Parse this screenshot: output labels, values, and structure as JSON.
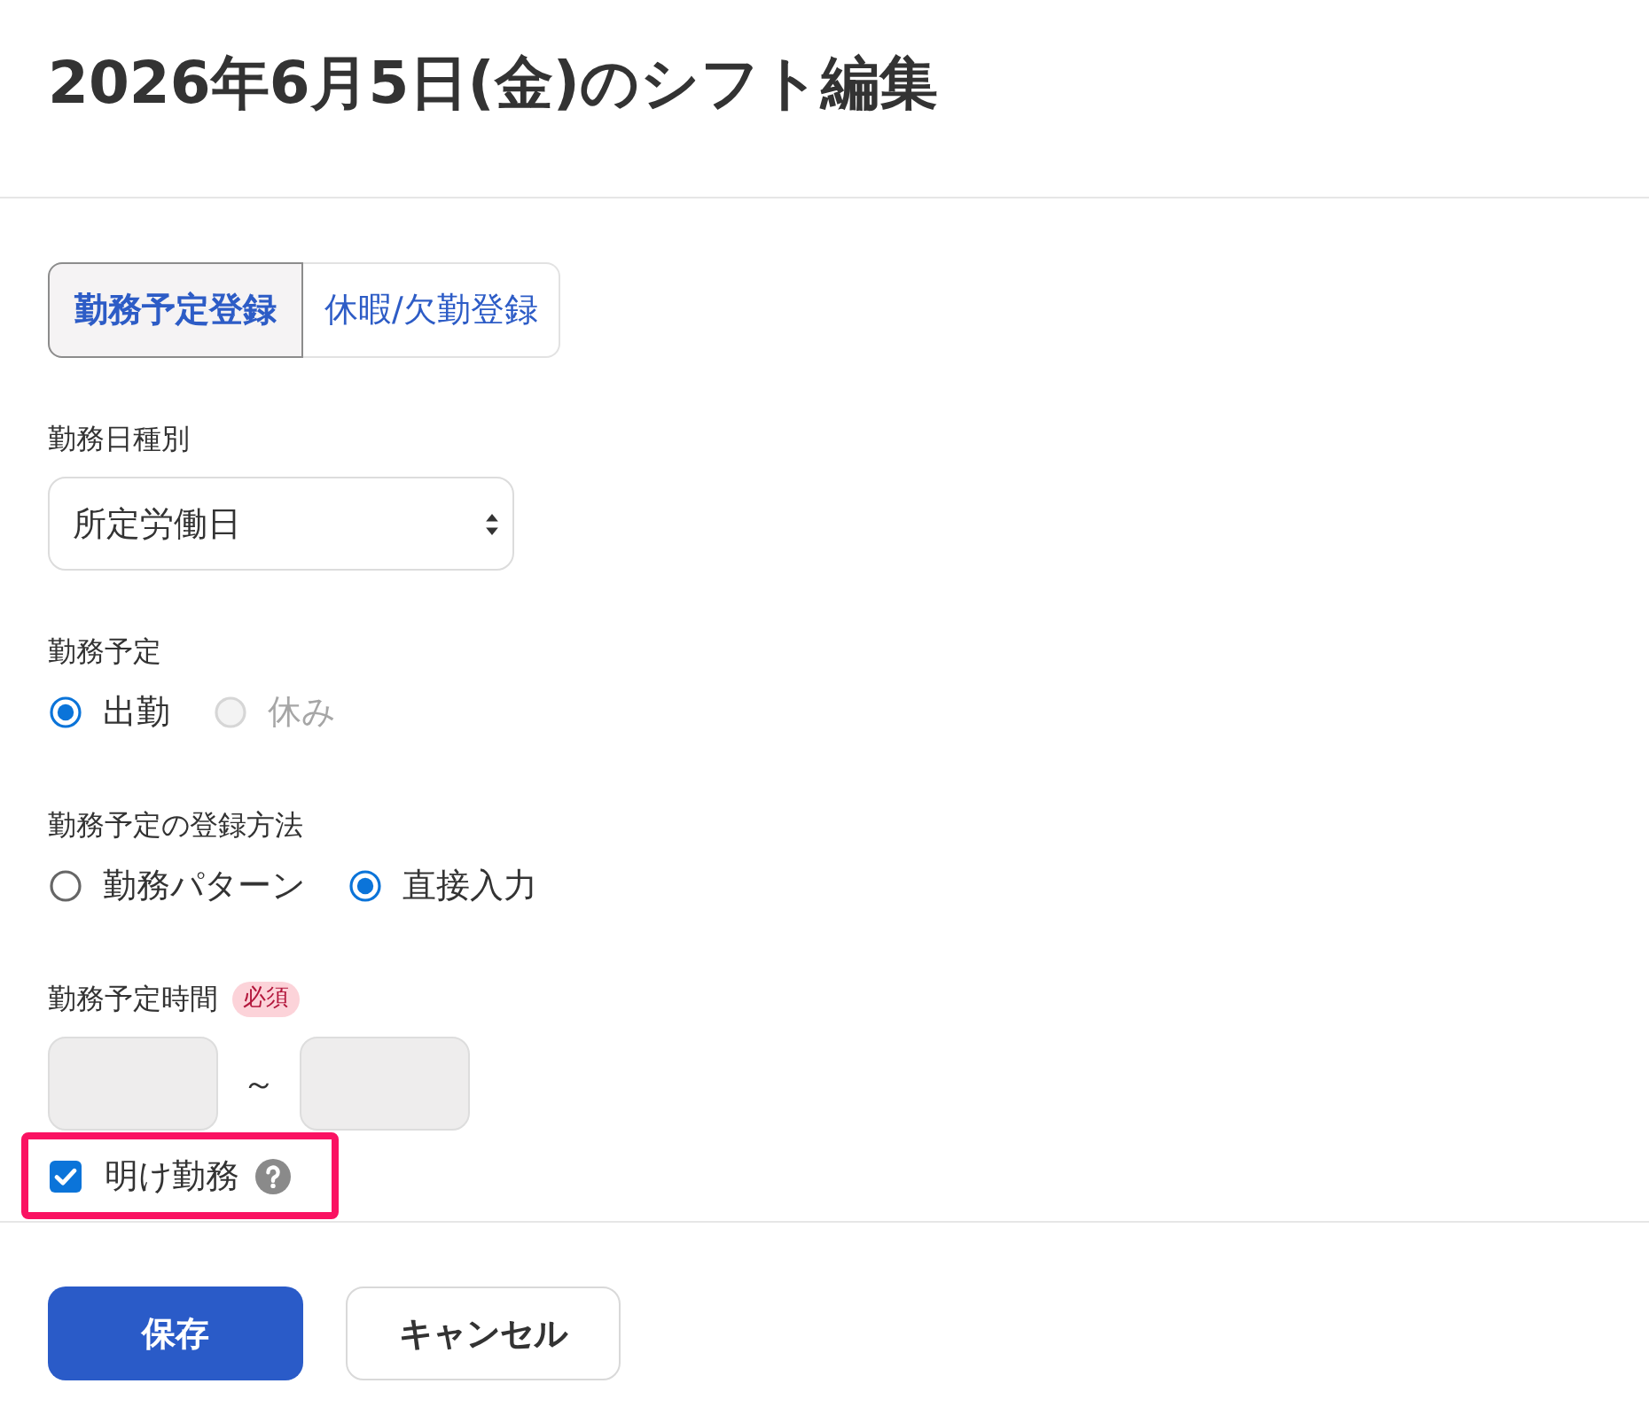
{
  "title": "2026年6月5日(金)のシフト編集",
  "tabs": [
    {
      "label": "勤務予定登録",
      "selected": true
    },
    {
      "label": "休暇/欠勤登録",
      "selected": false
    }
  ],
  "fields": [
    {
      "kind": "select",
      "label": "勤務日種別",
      "value": "所定労働日"
    },
    {
      "kind": "radio",
      "label": "勤務予定",
      "options": [
        {
          "label": "出勤",
          "selected": true,
          "disabled": false
        },
        {
          "label": "休み",
          "selected": false,
          "disabled": true
        }
      ]
    },
    {
      "kind": "radio",
      "label": "勤務予定の登録方法",
      "options": [
        {
          "label": "勤務パターン",
          "selected": false,
          "disabled": false
        },
        {
          "label": "直接入力",
          "selected": true,
          "disabled": false
        }
      ]
    },
    {
      "kind": "time_range",
      "label": "勤務予定時間",
      "badge": "必須",
      "separator": "～",
      "inputs": [
        {
          "disabled": true
        },
        {
          "disabled": true
        }
      ]
    },
    {
      "kind": "checkbox",
      "label": "明け勤務",
      "checked": true,
      "highlighted": true,
      "help": true
    }
  ],
  "buttons": [
    {
      "label": "保存",
      "kind": "primary"
    },
    {
      "label": "キャンセル",
      "kind": "secondary"
    }
  ]
}
